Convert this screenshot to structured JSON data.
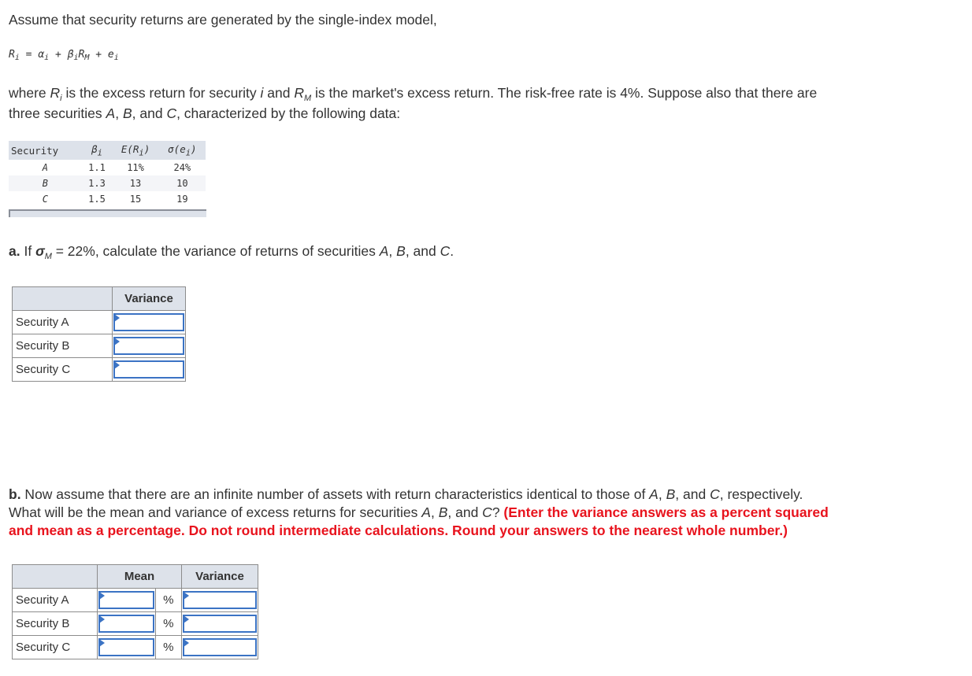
{
  "intro": {
    "line1": "Assume that security returns are generated by the single-index model,",
    "formula": {
      "R": "R",
      "i": "i",
      "eq": " = ",
      "alpha": "α",
      "plus1": " + ",
      "beta": "β",
      "RM": "R",
      "M": "M",
      "plus2": " + ",
      "e": "e"
    },
    "where_p1": "where ",
    "where_R": "R",
    "where_i": "i",
    "where_p2": " is the excess return for security ",
    "where_sec": "i",
    "where_p3": " and ",
    "where_RM": "R",
    "where_M": "M",
    "where_p4": " is the market's excess return. The risk-free rate is 4%. Suppose also that there are",
    "line3_p1": "three securities ",
    "line3_A": "A",
    "line3_p2": ", ",
    "line3_B": "B",
    "line3_p3": ", and ",
    "line3_C": "C",
    "line3_p4": ", characterized by the following data:"
  },
  "data_table": {
    "headers": {
      "security": "Security",
      "beta": "β",
      "beta_sub": "i",
      "er": "E(R",
      "er_sub": "i",
      "er_end": ")",
      "sigma": "σ(e",
      "sigma_sub": "i",
      "sigma_end": ")"
    },
    "rows": [
      {
        "security": "A",
        "beta": "1.1",
        "er": "11%",
        "sigma": "24%"
      },
      {
        "security": "B",
        "beta": "1.3",
        "er": "13",
        "sigma": "10"
      },
      {
        "security": "C",
        "beta": "1.5",
        "er": "15",
        "sigma": "19"
      }
    ]
  },
  "part_a": {
    "label": "a.",
    "text_p1": " If ",
    "sigma": "σ",
    "sigma_sub": "M",
    "text_p2": " = 22%, calculate the variance of returns of securities ",
    "A": "A",
    "sep1": ", ",
    "B": "B",
    "sep2": ", and ",
    "C": "C",
    "end": ".",
    "table": {
      "header": "Variance",
      "rows": [
        {
          "label": "Security A",
          "variance": ""
        },
        {
          "label": "Security B",
          "variance": ""
        },
        {
          "label": "Security C",
          "variance": ""
        }
      ]
    }
  },
  "part_b": {
    "label": "b.",
    "line1_p1": " Now assume that there are an infinite number of assets with return characteristics identical to those of ",
    "A": "A",
    "sep1": ", ",
    "B": "B",
    "sep2": ", and ",
    "C": "C",
    "line1_end": ", respectively.",
    "line2_p1": "What will be the mean and variance of excess returns for securities ",
    "line2_end": "? ",
    "instruction_1": "(Enter the variance answers as a percent squared",
    "instruction_2": "and mean as a percentage. Do not round intermediate calculations. Round your answers to the nearest whole number.)",
    "table": {
      "header_mean": "Mean",
      "header_variance": "Variance",
      "unit": "%",
      "rows": [
        {
          "label": "Security A",
          "mean": "",
          "variance": ""
        },
        {
          "label": "Security B",
          "mean": "",
          "variance": ""
        },
        {
          "label": "Security C",
          "mean": "",
          "variance": ""
        }
      ]
    }
  },
  "colors": {
    "instruction_red": "#e8131d",
    "input_border": "#3b73c4",
    "header_bg": "#dde2ea"
  }
}
